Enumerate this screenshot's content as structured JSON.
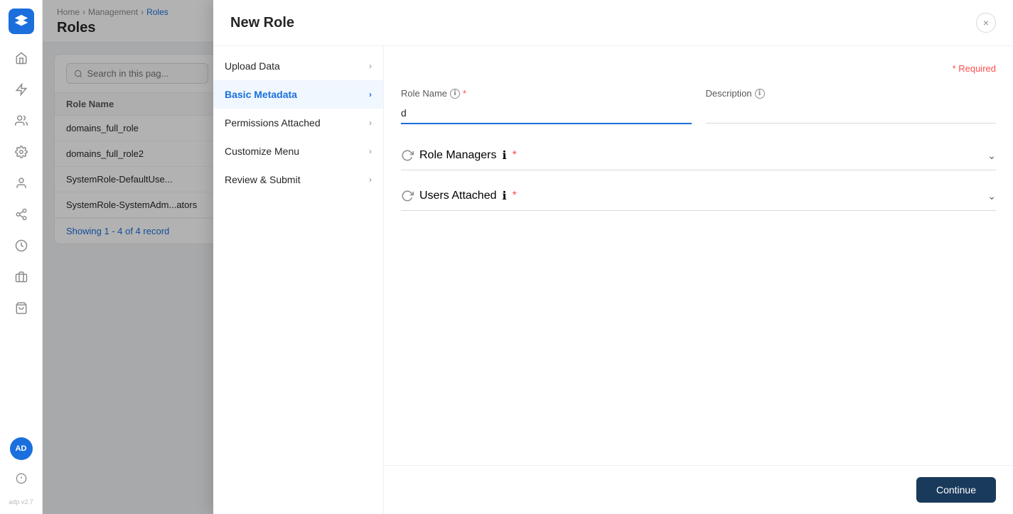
{
  "sidebar": {
    "logo_alt": "App Logo",
    "avatar_initials": "AD",
    "version": "adp v2.7",
    "nav_icons": [
      "home",
      "flash",
      "people-group",
      "settings",
      "person",
      "workflow",
      "clock",
      "team",
      "bag"
    ]
  },
  "page": {
    "breadcrumb": {
      "home": "Home",
      "separator1": "›",
      "management": "Management",
      "separator2": "›",
      "current": "Roles"
    },
    "title": "Roles"
  },
  "roles_table": {
    "search_placeholder": "Search in this pag...",
    "showing_top": "Showing 1 - 4 of 4 record",
    "showing_bottom": "Showing 1 - 4 of 4 record",
    "column_header": "Role Name",
    "rows": [
      {
        "name": "domains_full_role"
      },
      {
        "name": "domains_full_role2"
      },
      {
        "name": "SystemRole-DefaultUse..."
      },
      {
        "name": "SystemRole-SystemAdm...ators"
      }
    ]
  },
  "modal": {
    "title": "New Role",
    "close_label": "×",
    "required_note": "* Required",
    "steps": [
      {
        "id": "upload-data",
        "label": "Upload Data",
        "active": false
      },
      {
        "id": "basic-metadata",
        "label": "Basic Metadata",
        "active": true
      },
      {
        "id": "permissions-attached",
        "label": "Permissions Attached",
        "active": false
      },
      {
        "id": "customize-menu",
        "label": "Customize Menu",
        "active": false
      },
      {
        "id": "review-submit",
        "label": "Review & Submit",
        "active": false
      }
    ],
    "form": {
      "role_name_label": "Role Name",
      "role_name_value": "d",
      "role_name_info": "ℹ",
      "description_label": "Description",
      "description_info": "ℹ",
      "role_managers_label": "Role Managers",
      "role_managers_info": "ℹ",
      "users_attached_label": "Users Attached",
      "users_attached_info": "ℹ",
      "continue_label": "Continue"
    }
  }
}
